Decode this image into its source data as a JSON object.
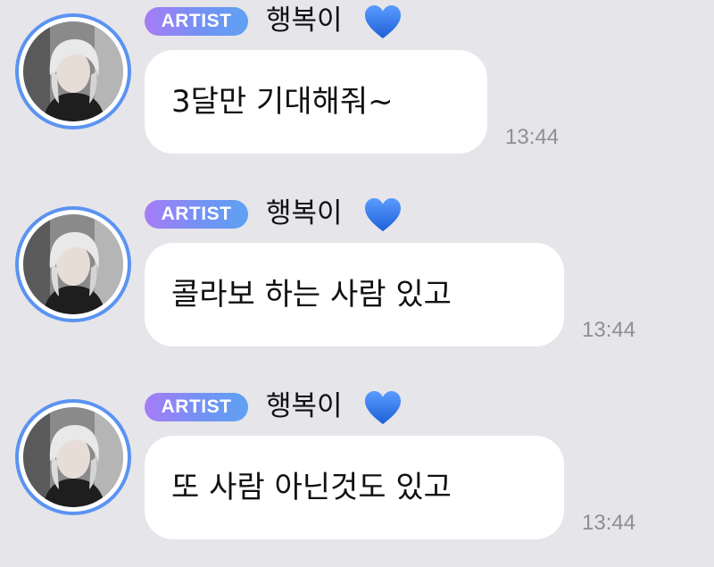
{
  "messages": [
    {
      "badge": "ARTIST",
      "sender": "행복이",
      "text": "3달만 기대해줘~",
      "time": "13:44"
    },
    {
      "badge": "ARTIST",
      "sender": "행복이",
      "text": "콜라보 하는 사람 있고",
      "time": "13:44"
    },
    {
      "badge": "ARTIST",
      "sender": "행복이",
      "text": "또 사람 아닌것도 있고",
      "time": "13:44"
    }
  ],
  "icons": {
    "heart": "blue-heart-icon"
  },
  "colors": {
    "background": "#e5e5ea",
    "bubble": "#ffffff",
    "avatar_ring": "#5b93f2",
    "badge_gradient_start": "#a67cf6",
    "badge_gradient_end": "#5ea1f2",
    "heart": "#2b6ee8",
    "timestamp": "#8e8e93"
  }
}
